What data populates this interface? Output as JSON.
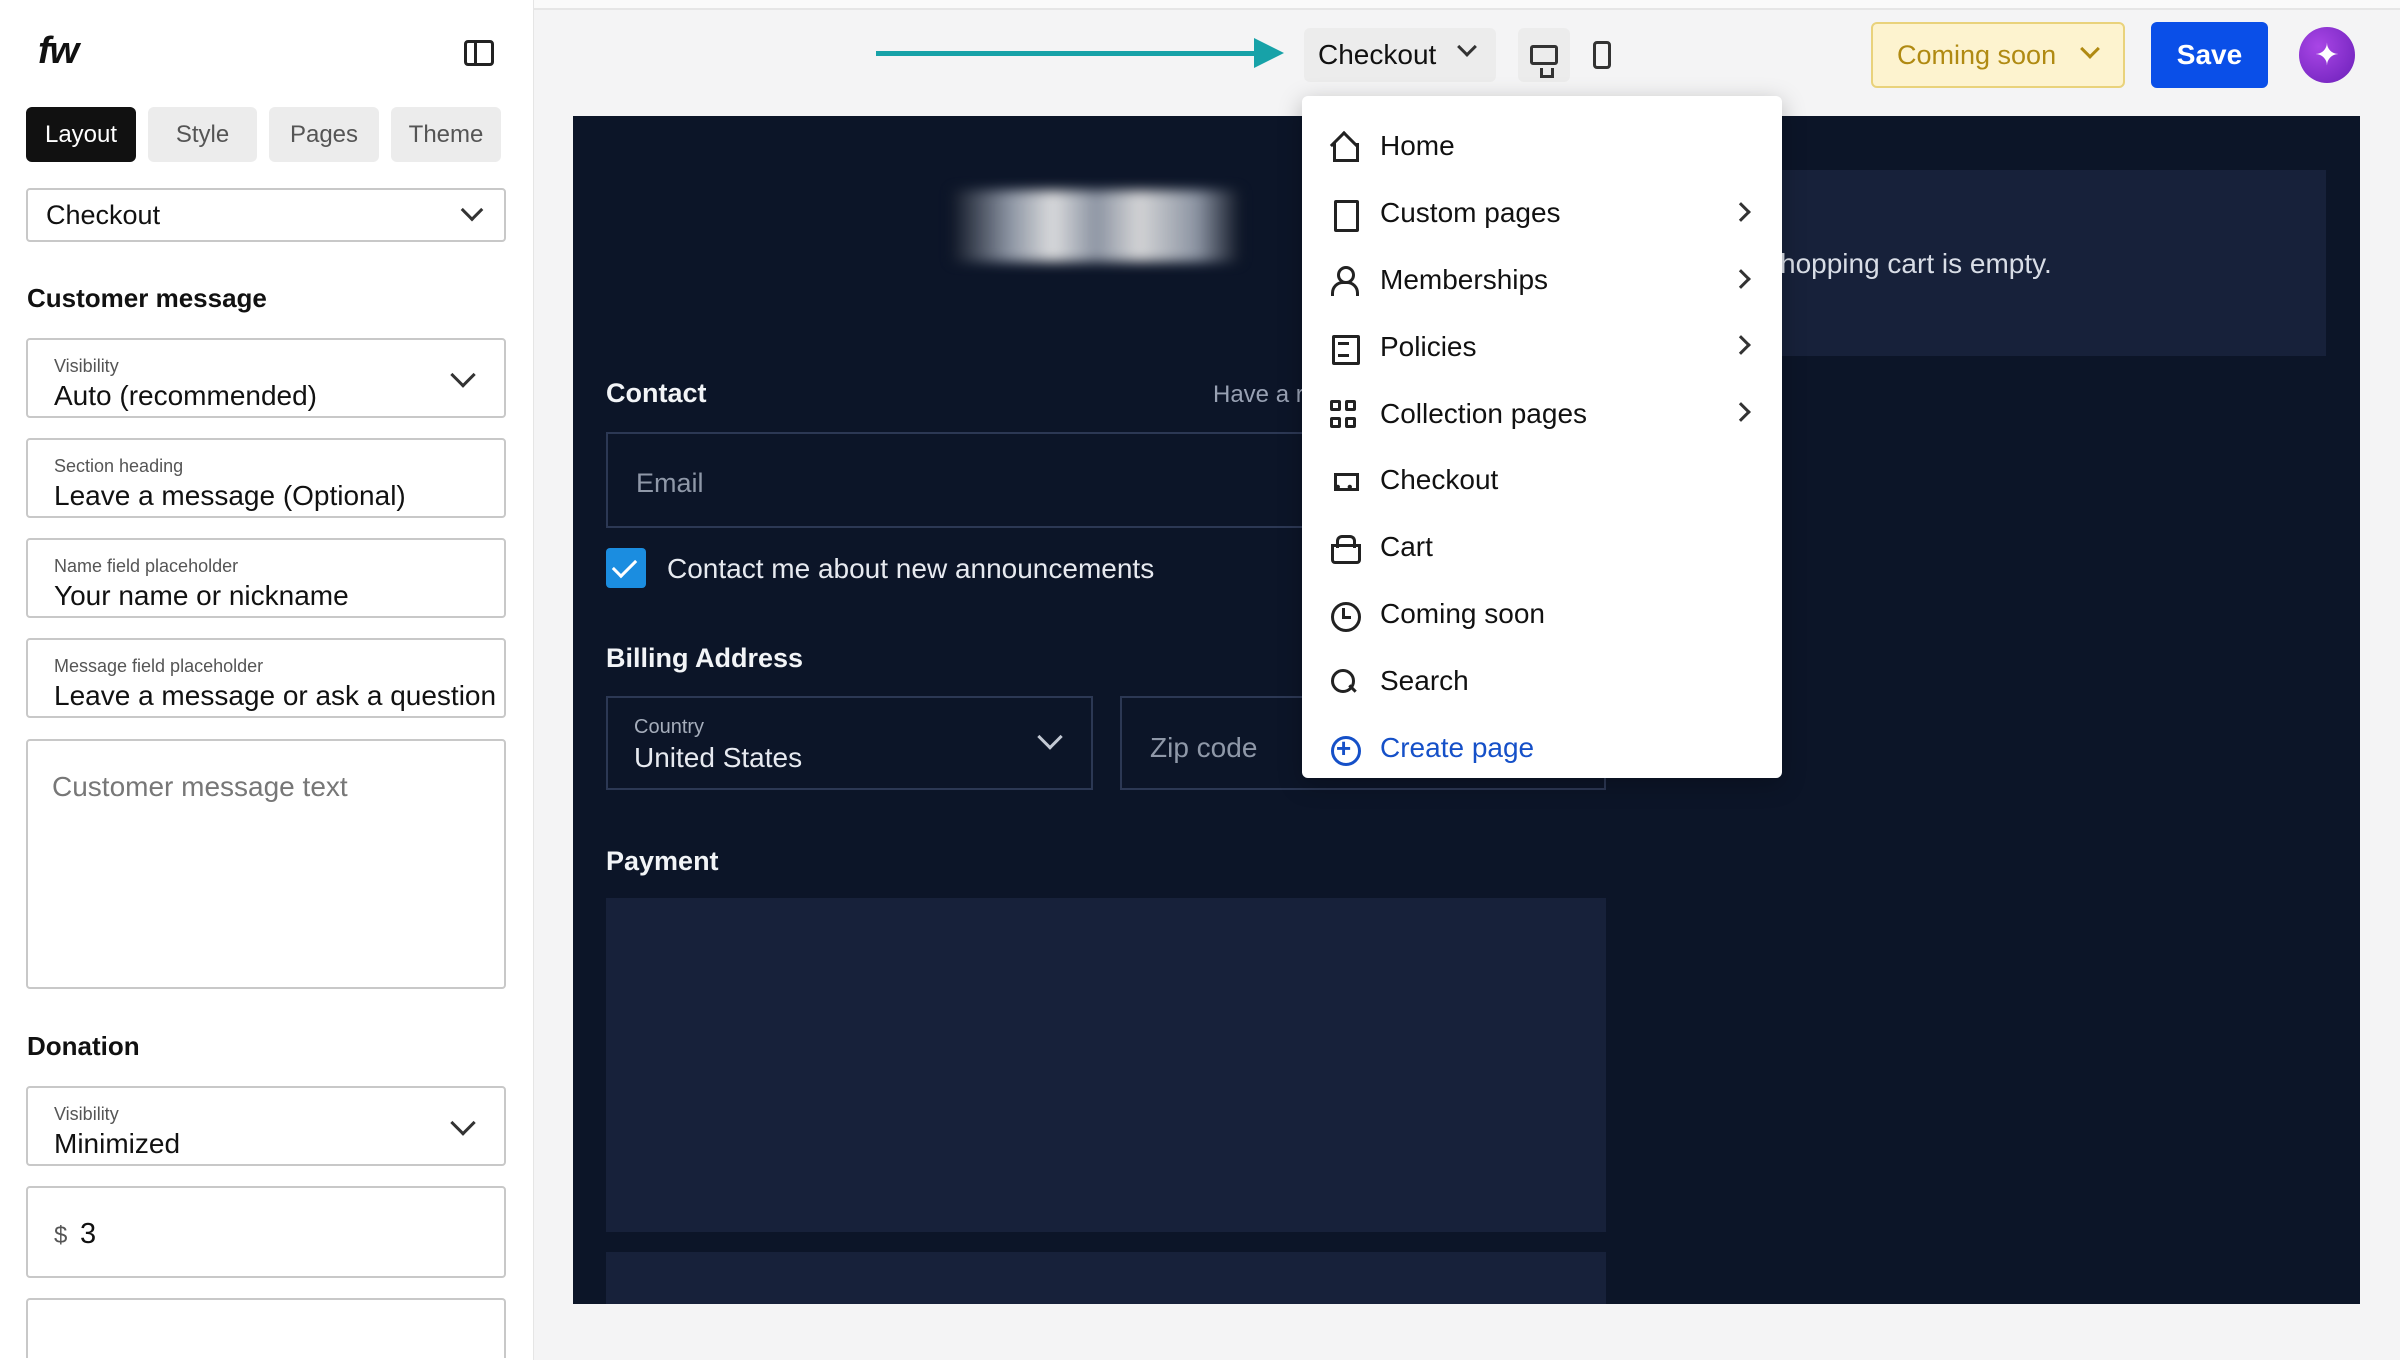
{
  "app": {
    "logo": "fw"
  },
  "sidebar": {
    "tabs": [
      {
        "label": "Layout"
      },
      {
        "label": "Style"
      },
      {
        "label": "Pages"
      },
      {
        "label": "Theme"
      }
    ],
    "page_select": "Checkout",
    "customer_message": {
      "title": "Customer message",
      "visibility_label": "Visibility",
      "visibility_value": "Auto (recommended)",
      "section_heading_label": "Section heading",
      "section_heading_value": "Leave a message  (Optional)",
      "name_placeholder_label": "Name field placeholder",
      "name_placeholder_value": "Your name or nickname",
      "message_placeholder_label": "Message field placeholder",
      "message_placeholder_value": "Leave a message or ask a question",
      "text_placeholder": "Customer message text"
    },
    "donation": {
      "title": "Donation",
      "visibility_label": "Visibility",
      "visibility_value": "Minimized",
      "currency": "$",
      "amount": "3"
    }
  },
  "topbar": {
    "page_picker": "Checkout",
    "status_label": "Coming soon",
    "save_label": "Save",
    "ai_icon": "sparkle-icon"
  },
  "dropdown": {
    "items": [
      {
        "label": "Home",
        "icon": "home-icon"
      },
      {
        "label": "Custom pages",
        "icon": "document-icon"
      },
      {
        "label": "Memberships",
        "icon": "user-icon"
      },
      {
        "label": "Policies",
        "icon": "list-icon"
      },
      {
        "label": "Collection pages",
        "icon": "grid-icon"
      },
      {
        "label": "Checkout",
        "icon": "cart-icon"
      },
      {
        "label": "Cart",
        "icon": "basket-icon"
      },
      {
        "label": "Coming soon",
        "icon": "clock-icon"
      },
      {
        "label": "Search",
        "icon": "search-icon"
      },
      {
        "label": "Create page",
        "icon": "plus-circle-icon"
      }
    ]
  },
  "preview": {
    "cart_empty": "hopping cart is empty.",
    "contact_label": "Contact",
    "have_account": "Have a r",
    "email_placeholder": "Email",
    "announcements": "Contact me about new announcements",
    "billing_label": "Billing Address",
    "country_label": "Country",
    "country_value": "United States",
    "zip_placeholder": "Zip code",
    "payment_label": "Payment"
  },
  "colors": {
    "accent": "#0a4fe8",
    "canvas_bg": "#0c1528",
    "arrow": "#17a2a8",
    "status_bg": "#fdf3cf"
  }
}
